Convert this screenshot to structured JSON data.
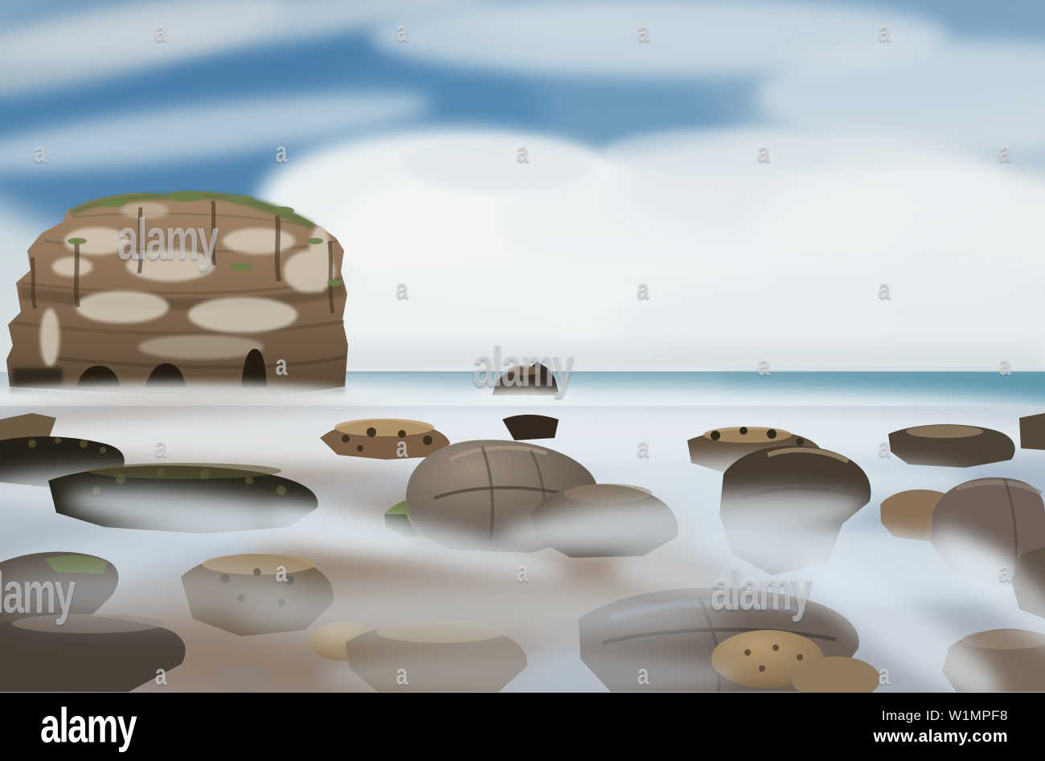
{
  "watermark": {
    "brand": "alamy",
    "letter": "a"
  },
  "footer": {
    "logo": "alamy",
    "image_id": "Image ID: W1MPF8",
    "url": "www.alamy.com"
  },
  "colors": {
    "sky_blue": "#4178a8",
    "cloud_white": "#f3f5f4",
    "sea_teal": "#669bb0",
    "mist_white": "#e9eff3",
    "sand_brown": "#9b8878",
    "rock_brown": "#8a6f55",
    "boulder_grey": "#6f6358",
    "seaweed_dark": "#28251b",
    "footer_bg": "#000000",
    "footer_text": "#ffffff"
  }
}
